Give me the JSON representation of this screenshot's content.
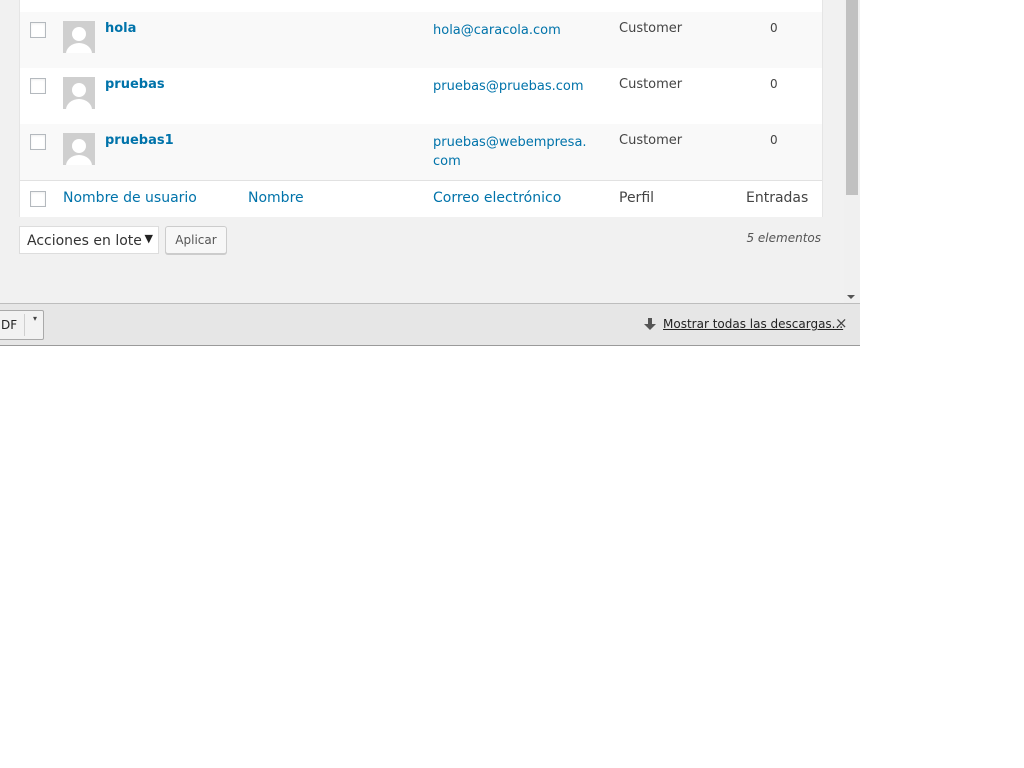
{
  "users_table": {
    "rows": [
      {
        "username": "hola",
        "email": "hola@caracola.com",
        "role": "Customer",
        "posts": "0"
      },
      {
        "username": "pruebas",
        "email": "pruebas@pruebas.com",
        "role": "Customer",
        "posts": "0"
      },
      {
        "username": "pruebas1",
        "email": "pruebas@webempresa.com",
        "role": "Customer",
        "posts": "0"
      }
    ],
    "footer_columns": {
      "username": "Nombre de usuario",
      "name": "Nombre",
      "email": "Correo electrónico",
      "role": "Perfil",
      "posts": "Entradas"
    }
  },
  "bulk_actions": {
    "selected": "Acciones en lote",
    "apply_label": "Aplicar"
  },
  "item_count": "5 elementos",
  "downloads_bar": {
    "item_label": "DF",
    "show_all_label": "Mostrar todas las descargas...",
    "close_glyph": "×"
  },
  "colors": {
    "link": "#0073aa",
    "text": "#444444",
    "page_bg": "#f1f1f1",
    "avatar": "#cfcfcf"
  }
}
